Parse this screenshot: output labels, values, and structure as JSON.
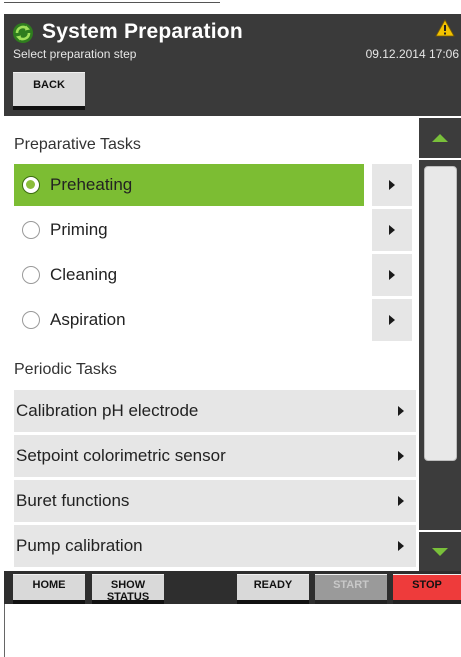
{
  "header": {
    "title": "System Preparation",
    "subtitle": "Select preparation step",
    "datetime": "09.12.2014 17:06",
    "back_label": "BACK"
  },
  "sections": {
    "preparative_title": "Preparative Tasks",
    "periodic_title": "Periodic Tasks"
  },
  "preparative_tasks": [
    {
      "label": "Preheating",
      "selected": true
    },
    {
      "label": "Priming",
      "selected": false
    },
    {
      "label": "Cleaning",
      "selected": false
    },
    {
      "label": "Aspiration",
      "selected": false
    }
  ],
  "periodic_tasks": [
    {
      "label": "Calibration pH electrode"
    },
    {
      "label": "Setpoint colorimetric sensor"
    },
    {
      "label": "Buret functions"
    },
    {
      "label": "Pump calibration"
    }
  ],
  "footer": {
    "home_label": "HOME",
    "show_status_label": "SHOW STATUS",
    "ready_label": "READY",
    "start_label": "START",
    "stop_label": "STOP"
  },
  "colors": {
    "accent_green": "#7cbd33",
    "stop_red": "#ee3b3b",
    "warning_yellow": "#f2c200"
  },
  "icons": {
    "logo": "recycle-arrows-icon",
    "warning": "warning-triangle-icon"
  }
}
